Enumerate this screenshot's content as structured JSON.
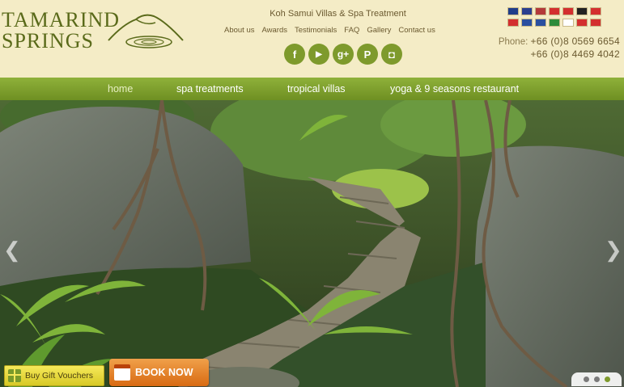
{
  "brand": {
    "line1": "Tamarind",
    "line2": "Springs"
  },
  "tagline": "Koh Samui Villas & Spa Treatment",
  "topnav": [
    "About us",
    "Awards",
    "Testimonials",
    "FAQ",
    "Gallery",
    "Contact us"
  ],
  "social": [
    {
      "name": "facebook-icon",
      "glyph": "f"
    },
    {
      "name": "youtube-icon",
      "glyph": "▶"
    },
    {
      "name": "google-plus-icon",
      "glyph": "g+"
    },
    {
      "name": "pinterest-icon",
      "glyph": "P"
    },
    {
      "name": "instagram-icon",
      "glyph": "◘"
    }
  ],
  "flags": [
    [
      {
        "name": "flag-australia",
        "color": "#1f3d8a"
      },
      {
        "name": "flag-uk",
        "color": "#2a3f8f"
      },
      {
        "name": "flag-usa",
        "color": "#b33a3a"
      },
      {
        "name": "flag-indonesia",
        "color": "#d32f2f"
      },
      {
        "name": "flag-canada",
        "color": "#d32f2f"
      },
      {
        "name": "flag-germany",
        "color": "#222222"
      },
      {
        "name": "flag-switzerland",
        "color": "#d32f2f"
      }
    ],
    [
      {
        "name": "flag-austria",
        "color": "#d32f2f"
      },
      {
        "name": "flag-france",
        "color": "#2a4fa0"
      },
      {
        "name": "flag-russia",
        "color": "#2a4fa0"
      },
      {
        "name": "flag-italy",
        "color": "#2e8b3a"
      },
      {
        "name": "flag-japan",
        "color": "#ffffff"
      },
      {
        "name": "flag-china",
        "color": "#d32f2f"
      },
      {
        "name": "flag-taiwan",
        "color": "#d32f2f"
      }
    ]
  ],
  "phone": {
    "label": "Phone:",
    "number1": "+66 (0)8 0569 6654",
    "number2": "+66 (0)8 4469 4042"
  },
  "mainnav": [
    "home",
    "spa treatments",
    "tropical villas",
    "yoga & 9 seasons restaurant"
  ],
  "hero": {
    "prev_glyph": "❮",
    "next_glyph": "❯"
  },
  "voucher_label": "Buy Gift Vouchers",
  "book_label": "BOOK NOW",
  "slider": {
    "count": 3,
    "active": 2
  },
  "colors": {
    "accent": "#7e9a2c",
    "nav": "#7a9b2e",
    "header": "#f4ecc6",
    "book": "#e07a1f"
  }
}
